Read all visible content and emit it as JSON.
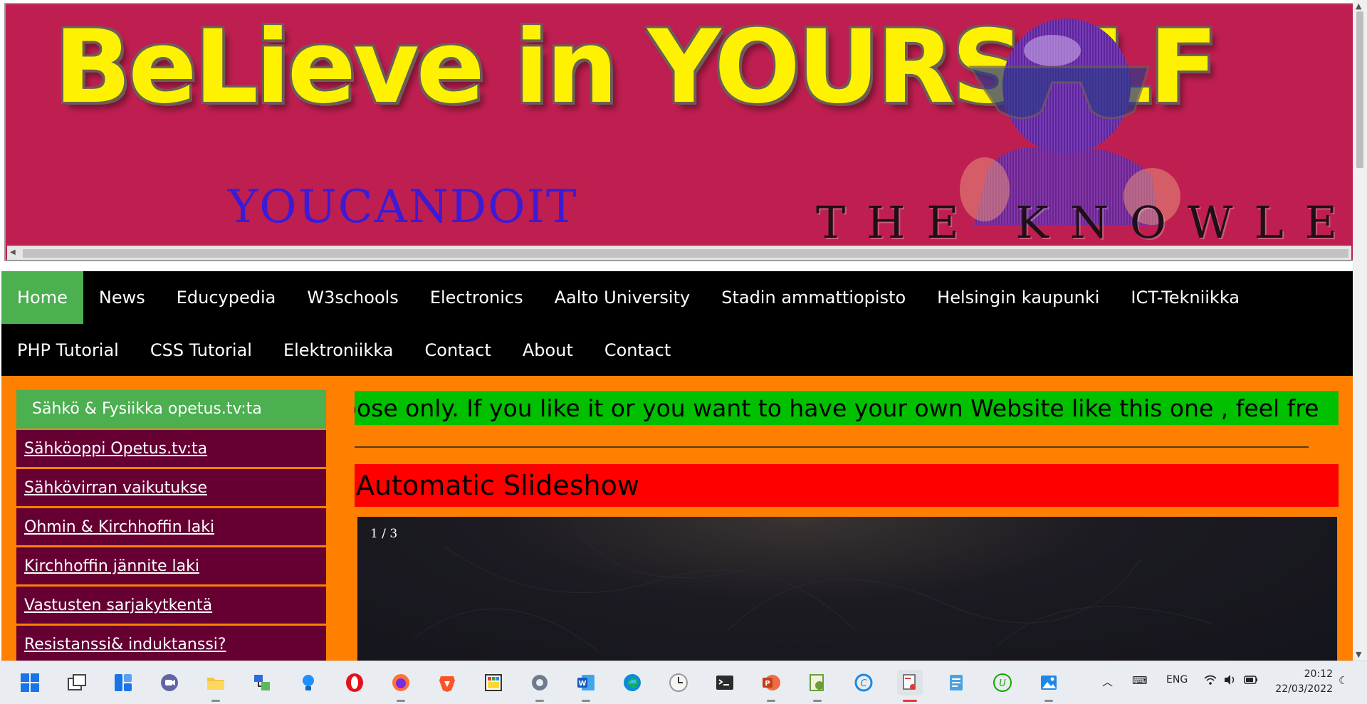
{
  "banner": {
    "title": "BeLieve in YOURSeLF",
    "subtitle": "YOUCANDOIT",
    "knowledge": "THE KNOWLEDGE I"
  },
  "nav": {
    "row1": [
      "Home",
      "News",
      "Educypedia",
      "W3schools",
      "Electronics",
      "Aalto University",
      "Stadin ammattiopisto",
      "Helsingin kaupunki",
      "ICT-Tekniikka"
    ],
    "row2": [
      "PHP Tutorial",
      "CSS Tutorial",
      "Elektroniikka",
      "Contact",
      "About",
      "Contact"
    ]
  },
  "sidebar": {
    "header": "Sähkö & Fysiikka opetus.tv:ta",
    "links": [
      "Sähköoppi Opetus.tv:ta",
      "Sähkövirran vaikutukse",
      "Ohmin & Kirchhoffin laki",
      "Kirchhoffin jännite laki",
      "Vastusten sarjakytkentä",
      "Resistanssi& induktanssi?"
    ]
  },
  "marquee": "pose only. If you like it or you want to have your own Website like this one , feel fre",
  "slideshow": {
    "title": "Automatic Slideshow",
    "counter": "1 / 3"
  },
  "taskbar": {
    "language": "ENG",
    "time": "20:12",
    "date": "22/03/2022"
  },
  "colors": {
    "banner_bg": "#be1f50",
    "nav_bg": "#000000",
    "nav_active": "#4caf50",
    "main_bg": "#ff8000",
    "sidebar_link_bg": "#660033",
    "marquee_bg": "#00c000",
    "slideshow_title_bg": "#ff0000"
  }
}
